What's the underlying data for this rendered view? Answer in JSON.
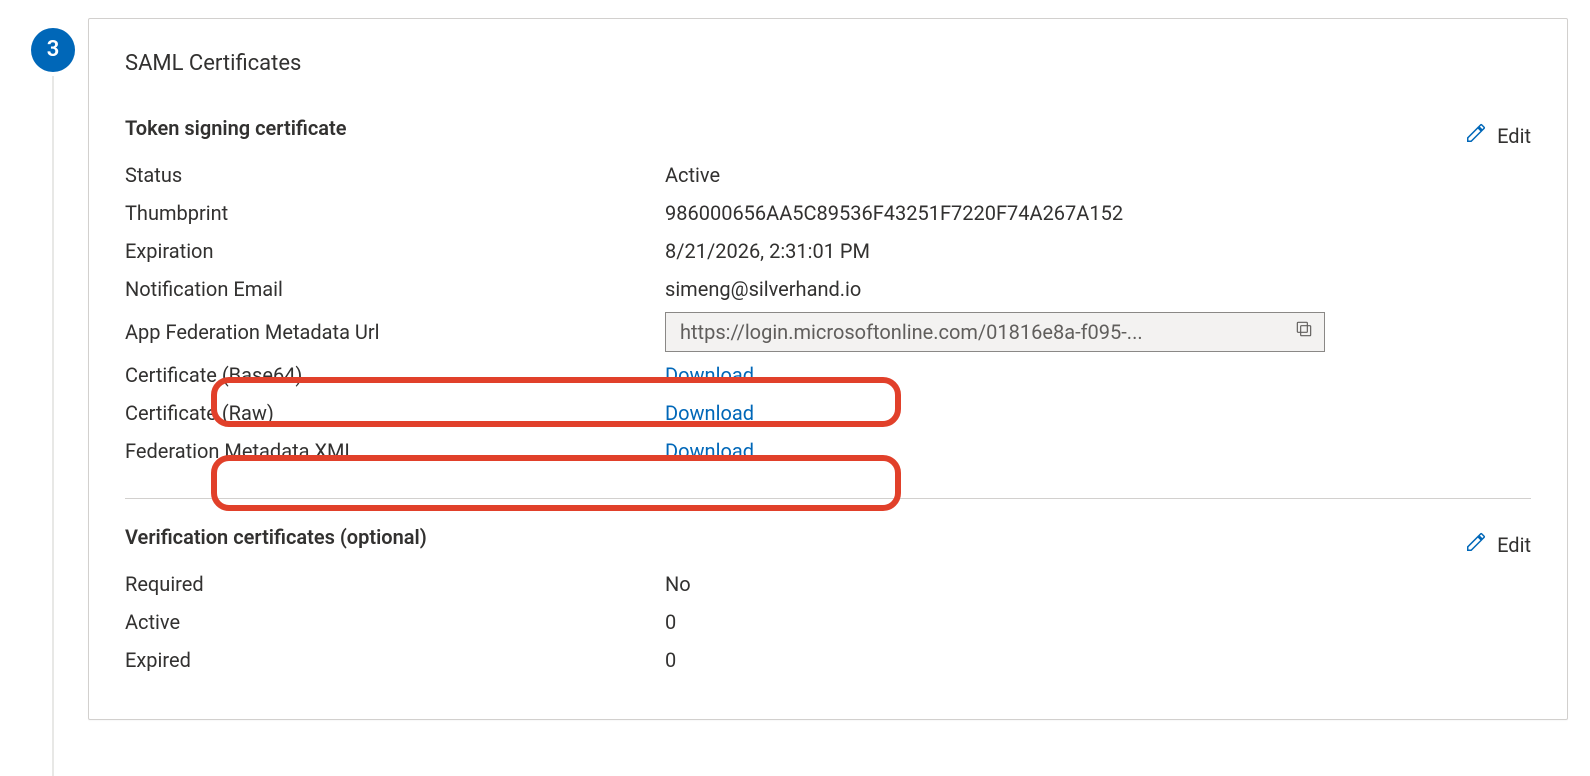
{
  "step_number": "3",
  "card": {
    "title": "SAML Certificates",
    "edit_label": "Edit",
    "token_signing": {
      "heading": "Token signing certificate",
      "rows": {
        "status_label": "Status",
        "status_value": "Active",
        "thumbprint_label": "Thumbprint",
        "thumbprint_value": "986000656AA5C89536F43251F7220F74A267A152",
        "expiration_label": "Expiration",
        "expiration_value": "8/21/2026, 2:31:01 PM",
        "notification_email_label": "Notification Email",
        "notification_email_value": "simeng@silverhand.io",
        "federation_url_label": "App Federation Metadata Url",
        "federation_url_value": "https://login.microsoftonline.com/01816e8a-f095-...",
        "cert_base64_label": "Certificate (Base64)",
        "cert_raw_label": "Certificate (Raw)",
        "fed_metadata_xml_label": "Federation Metadata XML",
        "download_label": "Download"
      }
    },
    "verification": {
      "heading": "Verification certificates (optional)",
      "rows": {
        "required_label": "Required",
        "required_value": "No",
        "active_label": "Active",
        "active_value": "0",
        "expired_label": "Expired",
        "expired_value": "0"
      }
    }
  }
}
